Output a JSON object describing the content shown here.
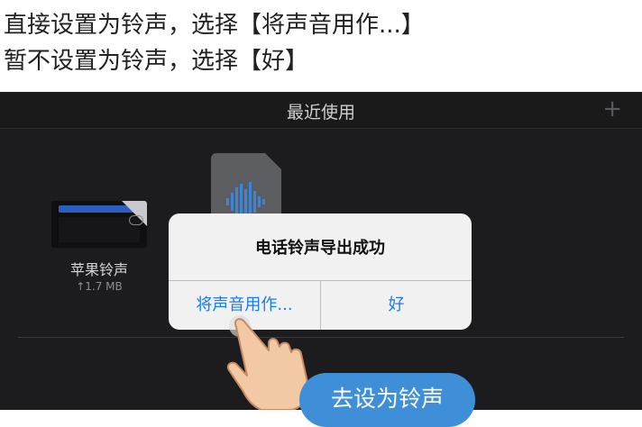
{
  "instructions": {
    "line1": "直接设置为铃声，选择【将声音用作...】",
    "line2": "暂不设置为铃声，选择【好】"
  },
  "nav": {
    "title": "最近使用",
    "add_glyph": "+"
  },
  "project": {
    "name": "苹果铃声",
    "size": "↑1.7 MB"
  },
  "alert": {
    "title": "电话铃声导出成功",
    "left_button": "将声音用作...",
    "right_button": "好"
  },
  "cta_button": "去设为铃声",
  "colors": {
    "screen_bg": "#1c1c1e",
    "alert_bg": "#f1f1f2",
    "alert_button_text": "#1a7cf2",
    "cta_bg": "#3f8fd8"
  },
  "icons": [
    "plus-icon",
    "document-waveform-icon",
    "cloud-icon",
    "hand-pointer-icon"
  ]
}
